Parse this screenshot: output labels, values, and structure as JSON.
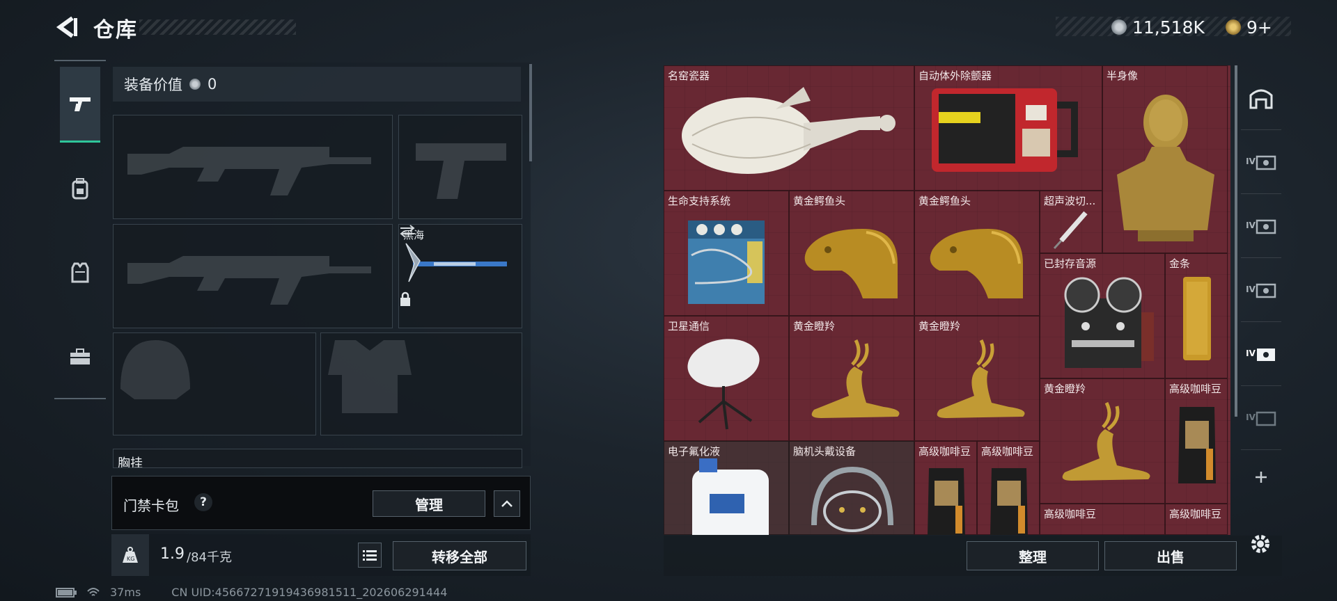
{
  "header": {
    "title": "仓库",
    "currency_main": "11,518K",
    "currency_secondary": "9+"
  },
  "left_tabs": [
    "gun-icon",
    "backpack-icon",
    "vest-icon",
    "toolbox-icon"
  ],
  "equipment": {
    "value_label": "装备价值",
    "value_amount": "0",
    "melee_name": "黑海",
    "next_section_label": "胸挂"
  },
  "access_card": {
    "label": "门禁卡包",
    "help": "?",
    "manage_button": "管理"
  },
  "weight": {
    "current": "1.9",
    "max": "/84千克"
  },
  "transfer_all_button": "转移全部",
  "stash": {
    "items": [
      {
        "label": "名窑瓷器"
      },
      {
        "label": "自动体外除颤器"
      },
      {
        "label": "半身像"
      },
      {
        "label": "生命支持系统"
      },
      {
        "label": "黄金鳄鱼头"
      },
      {
        "label": "黄金鳄鱼头"
      },
      {
        "label": "超声波切..."
      },
      {
        "label": "已封存音源"
      },
      {
        "label": "金条"
      },
      {
        "label": "卫星通信"
      },
      {
        "label": "黄金瞪羚"
      },
      {
        "label": "黄金瞪羚"
      },
      {
        "label": "黄金瞪羚"
      },
      {
        "label": "高级咖啡豆"
      },
      {
        "label": "电子氟化液"
      },
      {
        "label": "脑机头戴设备"
      },
      {
        "label": "高级咖啡豆"
      },
      {
        "label": "高级咖啡豆"
      },
      {
        "label": "高级咖啡豆"
      },
      {
        "label": "高级咖啡豆"
      }
    ],
    "sort_button": "整理",
    "sell_button": "出售"
  },
  "right_tabs": [
    "vault-icon",
    "IV",
    "IV",
    "IV",
    "IV",
    "IV"
  ],
  "status_bar": {
    "ping": "37ms",
    "uid": "CN UID:456672719194369815​11_202606291444"
  }
}
